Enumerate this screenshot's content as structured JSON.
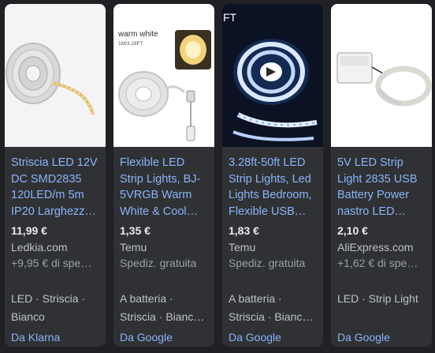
{
  "cards": [
    {
      "title": "Striscia LED 12V DC SMD2835 120LED/m 5m IP20 Larghezz…",
      "price": "11,99 €",
      "store": "Ledkia.com",
      "shipping": "+9,95 € di spe…",
      "tags": [
        "LED · Striscia ·",
        "Bianco"
      ],
      "source": "Da Klarna",
      "image_text": ""
    },
    {
      "title": "Flexible LED Strip Lights, BJ-5VRGB Warm White & Cool…",
      "price": "1,35 €",
      "store": "Temu",
      "shipping": "Spediz. gratuita",
      "tags": [
        "A batteria ·",
        "Striscia · Bianc…"
      ],
      "source": "Da Google",
      "image_text": "warm white",
      "image_subtext": "1M/3.28FT"
    },
    {
      "title": "3.28ft-50ft LED Strip Lights, Led Lights Bedroom, Flexible USB…",
      "price": "1,83 €",
      "store": "Temu",
      "shipping": "Spediz. gratuita",
      "tags": [
        "A batteria ·",
        "Striscia · Bianc…"
      ],
      "source": "Da Google",
      "image_text": "FT"
    },
    {
      "title": "5V LED Strip Light 2835 USB Battery Power nastro LED…",
      "price": "2,10 €",
      "store": "AliExpress.com",
      "shipping": "+1,62 € di spe…",
      "tags": [
        "LED · Strip Light"
      ],
      "source": "Da Google",
      "image_text": ""
    }
  ]
}
